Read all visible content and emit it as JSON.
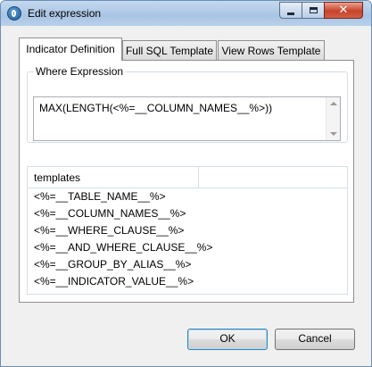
{
  "window": {
    "title": "Edit expression"
  },
  "tabs": [
    {
      "label": "Indicator Definition",
      "active": true
    },
    {
      "label": "Full SQL Template",
      "active": false
    },
    {
      "label": "View Rows Template",
      "active": false
    }
  ],
  "where_expression": {
    "label": "Where Expression",
    "value": "MAX(LENGTH(<%=__COLUMN_NAMES__%>))"
  },
  "templates_table": {
    "headers": [
      "templates",
      ""
    ],
    "rows": [
      "<%=__TABLE_NAME__%>",
      "<%=__COLUMN_NAMES__%>",
      "<%=__WHERE_CLAUSE__%>",
      "<%=__AND_WHERE_CLAUSE__%>",
      "<%=__GROUP_BY_ALIAS__%>",
      "<%=__INDICATOR_VALUE__%>"
    ]
  },
  "buttons": {
    "ok": "OK",
    "cancel": "Cancel"
  },
  "icons": {
    "app": "talend-app-icon",
    "minimize": "minimize-icon",
    "maximize": "maximize-icon",
    "close": "close-icon"
  },
  "colors": {
    "title_bar": "#b8d0eb",
    "close_button": "#c7432a",
    "default_button_border": "#3c7fb1"
  }
}
